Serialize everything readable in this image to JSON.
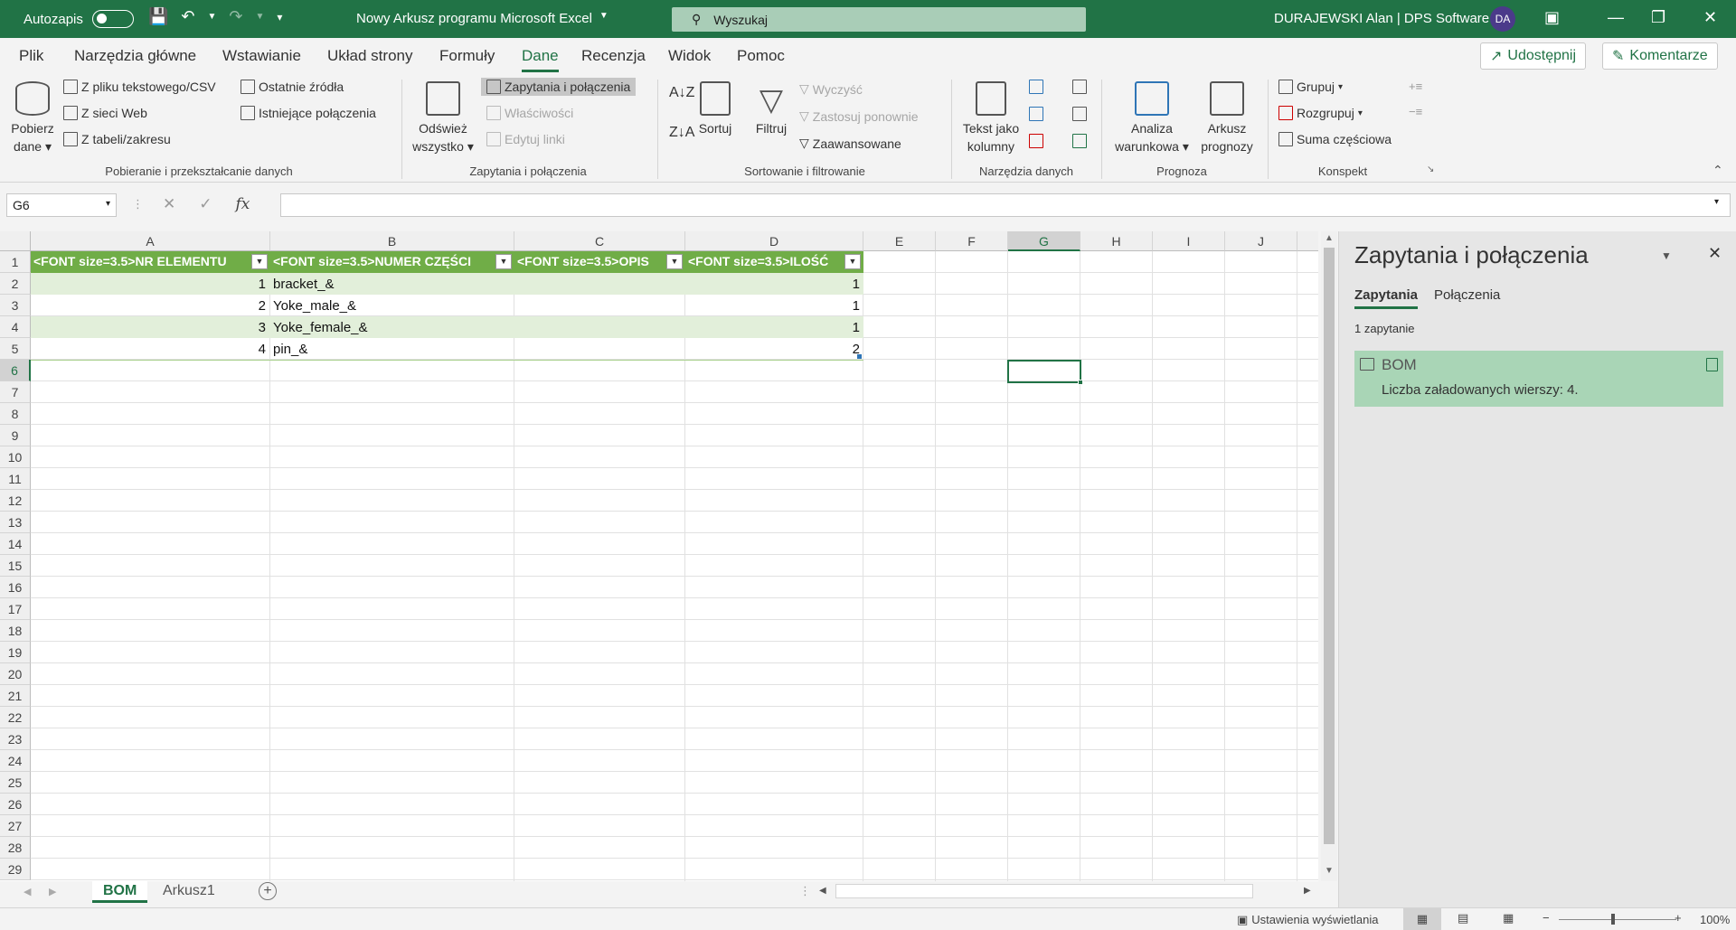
{
  "titlebar": {
    "autosave_label": "Autozapis",
    "document_title": "Nowy Arkusz programu Microsoft Excel",
    "search_placeholder": "Wyszukaj",
    "user_name": "DURAJEWSKI Alan | DPS Software",
    "user_initials": "DA"
  },
  "menu": {
    "tabs": [
      "Plik",
      "Narzędzia główne",
      "Wstawianie",
      "Układ strony",
      "Formuły",
      "Dane",
      "Recenzja",
      "Widok",
      "Pomoc"
    ],
    "active_tab": "Dane",
    "share_label": "Udostępnij",
    "comments_label": "Komentarze"
  },
  "ribbon": {
    "get_data": {
      "line1": "Pobierz",
      "line2": "dane"
    },
    "from_text": "Z pliku tekstowego/CSV",
    "from_web": "Z sieci Web",
    "from_table": "Z tabeli/zakresu",
    "recent_sources": "Ostatnie źródła",
    "existing_connections": "Istniejące połączenia",
    "group1_label": "Pobieranie i przekształcanie danych",
    "refresh_all": {
      "line1": "Odśwież",
      "line2": "wszystko"
    },
    "queries_connections": "Zapytania i połączenia",
    "properties": "Właściwości",
    "edit_links": "Edytuj linki",
    "group2_label": "Zapytania i połączenia",
    "sort": "Sortuj",
    "filter": "Filtruj",
    "clear": "Wyczyść",
    "reapply": "Zastosuj ponownie",
    "advanced": "Zaawansowane",
    "group3_label": "Sortowanie i filtrowanie",
    "text_to_columns": {
      "line1": "Tekst jako",
      "line2": "kolumny"
    },
    "group4_label": "Narzędzia danych",
    "what_if": {
      "line1": "Analiza",
      "line2": "warunkowa"
    },
    "forecast_sheet": {
      "line1": "Arkusz",
      "line2": "prognozy"
    },
    "group5_label": "Prognoza",
    "group": "Grupuj",
    "ungroup": "Rozgrupuj",
    "subtotal": "Suma częściowa",
    "group6_label": "Konspekt"
  },
  "formula_bar": {
    "name_box": "G6",
    "fx": "fx",
    "formula": ""
  },
  "grid": {
    "columns": [
      "A",
      "B",
      "C",
      "D",
      "E",
      "F",
      "G",
      "H",
      "I",
      "J"
    ],
    "selected_column": "G",
    "rows": [
      "1",
      "2",
      "3",
      "4",
      "5",
      "6",
      "7",
      "8",
      "9",
      "10",
      "11",
      "12",
      "13",
      "14",
      "15",
      "16",
      "17",
      "18",
      "19",
      "20",
      "21",
      "22",
      "23",
      "24",
      "25",
      "26",
      "27",
      "28",
      "29"
    ],
    "selected_row": "6",
    "table_headers": [
      "<FONT size=3.5>NR ELEMENTU",
      "<FONT size=3.5>NUMER CZĘŚCI",
      "<FONT size=3.5>OPIS",
      "<FONT size=3.5>ILOŚĆ"
    ],
    "table_rows": [
      {
        "nr": "1",
        "part": "bracket_&",
        "desc": "",
        "qty": "1"
      },
      {
        "nr": "2",
        "part": "Yoke_male_&",
        "desc": "",
        "qty": "1"
      },
      {
        "nr": "3",
        "part": "Yoke_female_&",
        "desc": "",
        "qty": "1"
      },
      {
        "nr": "4",
        "part": "pin_&",
        "desc": "",
        "qty": "2"
      }
    ]
  },
  "sheets": {
    "tabs": [
      "BOM",
      "Arkusz1"
    ],
    "active": "BOM"
  },
  "statusbar": {
    "display_settings": "Ustawienia wyświetlania",
    "zoom": "100%"
  },
  "panel": {
    "title": "Zapytania i połączenia",
    "tab_queries": "Zapytania",
    "tab_connections": "Połączenia",
    "count_label": "1 zapytanie",
    "query_name": "BOM",
    "query_rows": "Liczba załadowanych wierszy: 4."
  },
  "colors": {
    "excel_green": "#217346",
    "table_header": "#70ad47",
    "table_band": "#e2efda",
    "query_card": "#a9d5b6"
  }
}
